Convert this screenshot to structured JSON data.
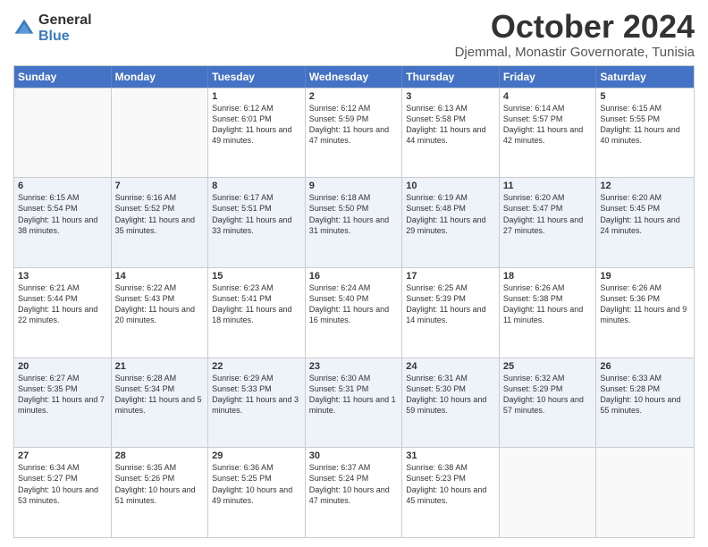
{
  "logo": {
    "general": "General",
    "blue": "Blue"
  },
  "title": "October 2024",
  "location": "Djemmal, Monastir Governorate, Tunisia",
  "days": [
    "Sunday",
    "Monday",
    "Tuesday",
    "Wednesday",
    "Thursday",
    "Friday",
    "Saturday"
  ],
  "weeks": [
    [
      {
        "day": "",
        "sunrise": "",
        "sunset": "",
        "daylight": ""
      },
      {
        "day": "",
        "sunrise": "",
        "sunset": "",
        "daylight": ""
      },
      {
        "day": "1",
        "sunrise": "Sunrise: 6:12 AM",
        "sunset": "Sunset: 6:01 PM",
        "daylight": "Daylight: 11 hours and 49 minutes."
      },
      {
        "day": "2",
        "sunrise": "Sunrise: 6:12 AM",
        "sunset": "Sunset: 5:59 PM",
        "daylight": "Daylight: 11 hours and 47 minutes."
      },
      {
        "day": "3",
        "sunrise": "Sunrise: 6:13 AM",
        "sunset": "Sunset: 5:58 PM",
        "daylight": "Daylight: 11 hours and 44 minutes."
      },
      {
        "day": "4",
        "sunrise": "Sunrise: 6:14 AM",
        "sunset": "Sunset: 5:57 PM",
        "daylight": "Daylight: 11 hours and 42 minutes."
      },
      {
        "day": "5",
        "sunrise": "Sunrise: 6:15 AM",
        "sunset": "Sunset: 5:55 PM",
        "daylight": "Daylight: 11 hours and 40 minutes."
      }
    ],
    [
      {
        "day": "6",
        "sunrise": "Sunrise: 6:15 AM",
        "sunset": "Sunset: 5:54 PM",
        "daylight": "Daylight: 11 hours and 38 minutes."
      },
      {
        "day": "7",
        "sunrise": "Sunrise: 6:16 AM",
        "sunset": "Sunset: 5:52 PM",
        "daylight": "Daylight: 11 hours and 35 minutes."
      },
      {
        "day": "8",
        "sunrise": "Sunrise: 6:17 AM",
        "sunset": "Sunset: 5:51 PM",
        "daylight": "Daylight: 11 hours and 33 minutes."
      },
      {
        "day": "9",
        "sunrise": "Sunrise: 6:18 AM",
        "sunset": "Sunset: 5:50 PM",
        "daylight": "Daylight: 11 hours and 31 minutes."
      },
      {
        "day": "10",
        "sunrise": "Sunrise: 6:19 AM",
        "sunset": "Sunset: 5:48 PM",
        "daylight": "Daylight: 11 hours and 29 minutes."
      },
      {
        "day": "11",
        "sunrise": "Sunrise: 6:20 AM",
        "sunset": "Sunset: 5:47 PM",
        "daylight": "Daylight: 11 hours and 27 minutes."
      },
      {
        "day": "12",
        "sunrise": "Sunrise: 6:20 AM",
        "sunset": "Sunset: 5:45 PM",
        "daylight": "Daylight: 11 hours and 24 minutes."
      }
    ],
    [
      {
        "day": "13",
        "sunrise": "Sunrise: 6:21 AM",
        "sunset": "Sunset: 5:44 PM",
        "daylight": "Daylight: 11 hours and 22 minutes."
      },
      {
        "day": "14",
        "sunrise": "Sunrise: 6:22 AM",
        "sunset": "Sunset: 5:43 PM",
        "daylight": "Daylight: 11 hours and 20 minutes."
      },
      {
        "day": "15",
        "sunrise": "Sunrise: 6:23 AM",
        "sunset": "Sunset: 5:41 PM",
        "daylight": "Daylight: 11 hours and 18 minutes."
      },
      {
        "day": "16",
        "sunrise": "Sunrise: 6:24 AM",
        "sunset": "Sunset: 5:40 PM",
        "daylight": "Daylight: 11 hours and 16 minutes."
      },
      {
        "day": "17",
        "sunrise": "Sunrise: 6:25 AM",
        "sunset": "Sunset: 5:39 PM",
        "daylight": "Daylight: 11 hours and 14 minutes."
      },
      {
        "day": "18",
        "sunrise": "Sunrise: 6:26 AM",
        "sunset": "Sunset: 5:38 PM",
        "daylight": "Daylight: 11 hours and 11 minutes."
      },
      {
        "day": "19",
        "sunrise": "Sunrise: 6:26 AM",
        "sunset": "Sunset: 5:36 PM",
        "daylight": "Daylight: 11 hours and 9 minutes."
      }
    ],
    [
      {
        "day": "20",
        "sunrise": "Sunrise: 6:27 AM",
        "sunset": "Sunset: 5:35 PM",
        "daylight": "Daylight: 11 hours and 7 minutes."
      },
      {
        "day": "21",
        "sunrise": "Sunrise: 6:28 AM",
        "sunset": "Sunset: 5:34 PM",
        "daylight": "Daylight: 11 hours and 5 minutes."
      },
      {
        "day": "22",
        "sunrise": "Sunrise: 6:29 AM",
        "sunset": "Sunset: 5:33 PM",
        "daylight": "Daylight: 11 hours and 3 minutes."
      },
      {
        "day": "23",
        "sunrise": "Sunrise: 6:30 AM",
        "sunset": "Sunset: 5:31 PM",
        "daylight": "Daylight: 11 hours and 1 minute."
      },
      {
        "day": "24",
        "sunrise": "Sunrise: 6:31 AM",
        "sunset": "Sunset: 5:30 PM",
        "daylight": "Daylight: 10 hours and 59 minutes."
      },
      {
        "day": "25",
        "sunrise": "Sunrise: 6:32 AM",
        "sunset": "Sunset: 5:29 PM",
        "daylight": "Daylight: 10 hours and 57 minutes."
      },
      {
        "day": "26",
        "sunrise": "Sunrise: 6:33 AM",
        "sunset": "Sunset: 5:28 PM",
        "daylight": "Daylight: 10 hours and 55 minutes."
      }
    ],
    [
      {
        "day": "27",
        "sunrise": "Sunrise: 6:34 AM",
        "sunset": "Sunset: 5:27 PM",
        "daylight": "Daylight: 10 hours and 53 minutes."
      },
      {
        "day": "28",
        "sunrise": "Sunrise: 6:35 AM",
        "sunset": "Sunset: 5:26 PM",
        "daylight": "Daylight: 10 hours and 51 minutes."
      },
      {
        "day": "29",
        "sunrise": "Sunrise: 6:36 AM",
        "sunset": "Sunset: 5:25 PM",
        "daylight": "Daylight: 10 hours and 49 minutes."
      },
      {
        "day": "30",
        "sunrise": "Sunrise: 6:37 AM",
        "sunset": "Sunset: 5:24 PM",
        "daylight": "Daylight: 10 hours and 47 minutes."
      },
      {
        "day": "31",
        "sunrise": "Sunrise: 6:38 AM",
        "sunset": "Sunset: 5:23 PM",
        "daylight": "Daylight: 10 hours and 45 minutes."
      },
      {
        "day": "",
        "sunrise": "",
        "sunset": "",
        "daylight": ""
      },
      {
        "day": "",
        "sunrise": "",
        "sunset": "",
        "daylight": ""
      }
    ]
  ]
}
